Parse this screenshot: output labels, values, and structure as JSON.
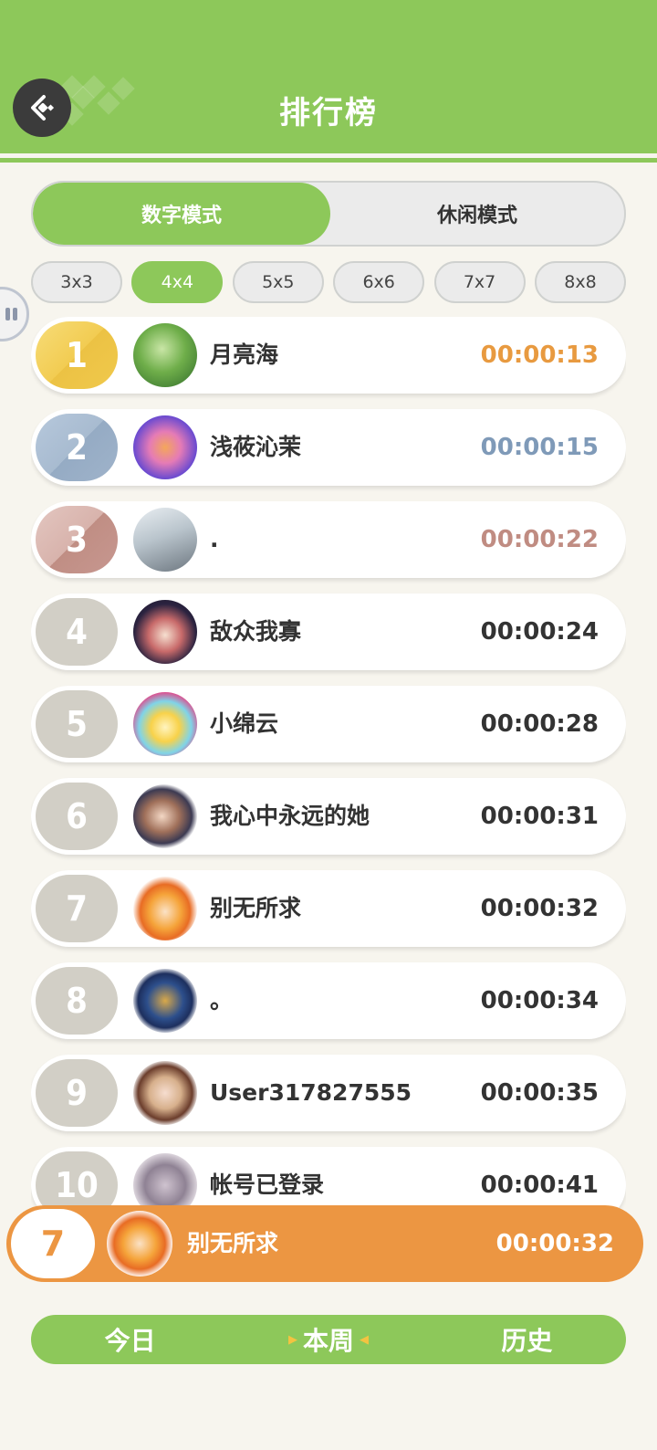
{
  "header": {
    "title": "排行榜",
    "back_icon": "back-arrow-icon"
  },
  "modes": [
    {
      "label": "数字模式",
      "active": true
    },
    {
      "label": "休闲模式",
      "active": false
    }
  ],
  "sizes": [
    {
      "label": "3x3",
      "active": false
    },
    {
      "label": "4x4",
      "active": true
    },
    {
      "label": "5x5",
      "active": false
    },
    {
      "label": "6x6",
      "active": false
    },
    {
      "label": "7x7",
      "active": false
    },
    {
      "label": "8x8",
      "active": false
    }
  ],
  "leaderboard": [
    {
      "rank": "1",
      "name": "月亮海",
      "time": "00:00:13"
    },
    {
      "rank": "2",
      "name": "浅莜沁茉",
      "time": "00:00:15"
    },
    {
      "rank": "3",
      "name": ".",
      "time": "00:00:22"
    },
    {
      "rank": "4",
      "name": "敌众我寡",
      "time": "00:00:24"
    },
    {
      "rank": "5",
      "name": "小绵云",
      "time": "00:00:28"
    },
    {
      "rank": "6",
      "name": "我心中永远的她",
      "time": "00:00:31"
    },
    {
      "rank": "7",
      "name": "别无所求",
      "time": "00:00:32"
    },
    {
      "rank": "8",
      "name": "。",
      "time": "00:00:34"
    },
    {
      "rank": "9",
      "name": "User317827555",
      "time": "00:00:35"
    },
    {
      "rank": "10",
      "name": "帐号已登录",
      "time": "00:00:41"
    }
  ],
  "my_entry": {
    "rank": "7",
    "name": "别无所求",
    "time": "00:00:32"
  },
  "periods": [
    {
      "label": "今日",
      "active": false
    },
    {
      "label": "本周",
      "active": true
    },
    {
      "label": "历史",
      "active": false
    }
  ],
  "colors": {
    "accent_green": "#8dc85a",
    "gold": "#f0c94c",
    "silver": "#9fb3ca",
    "bronze": "#c79790",
    "my_entry_orange": "#ec9642",
    "time_gold": "#e89a40",
    "time_silver": "#7f9ab8",
    "time_bronze": "#c08c82"
  }
}
